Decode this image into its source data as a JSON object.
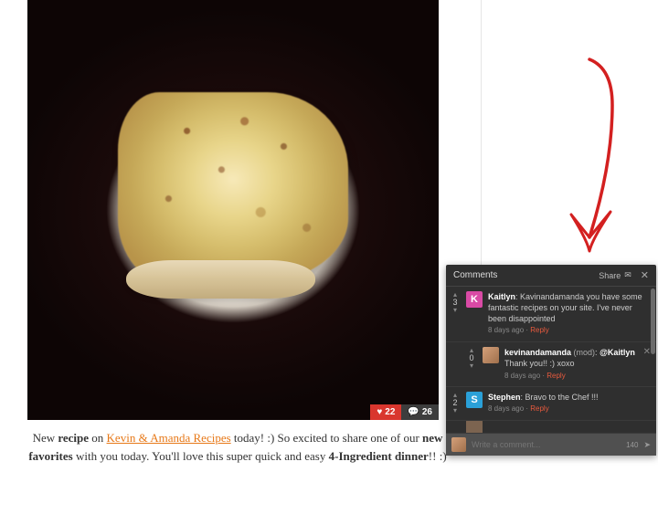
{
  "photo": {
    "heart_count": "22",
    "comment_count": "26"
  },
  "caption": {
    "t1": "New ",
    "bold1": "recipe",
    "t2": " on ",
    "link": "Kevin & Amanda Recipes",
    "t3": " today! :) So excited to share one of our ",
    "bold2": "new favorites",
    "t4": " with you today. You'll love this super quick and easy ",
    "bold3": "4-Ingredient dinner",
    "t5": "!! :)"
  },
  "widget": {
    "title": "Comments",
    "share_label": "Share",
    "close_glyph": "✕",
    "input_placeholder": "Write a comment...",
    "char_limit": "140",
    "comments": [
      {
        "votes": "3",
        "avatar_letter": "K",
        "avatar_class": "k",
        "user": "Kaitlyn",
        "body": ": Kavinandamanda you have some fantastic recipes on your site. I've never been disappointed",
        "time": "8 days ago",
        "reply": "Reply"
      },
      {
        "votes": "0",
        "avatar_letter": "",
        "avatar_class": "img",
        "user": "kevinandamanda",
        "mod": " (mod)",
        "mention": "@Kaitlyn",
        "body": " Thank you!! :) xoxo",
        "time": "8 days ago",
        "reply": "Reply",
        "nested": true,
        "closable": true
      },
      {
        "votes": "2",
        "avatar_letter": "S",
        "avatar_class": "s",
        "user": "Stephen",
        "body": ": Bravo to the Chef !!!",
        "time": "8 days ago",
        "reply": "Reply"
      }
    ]
  }
}
